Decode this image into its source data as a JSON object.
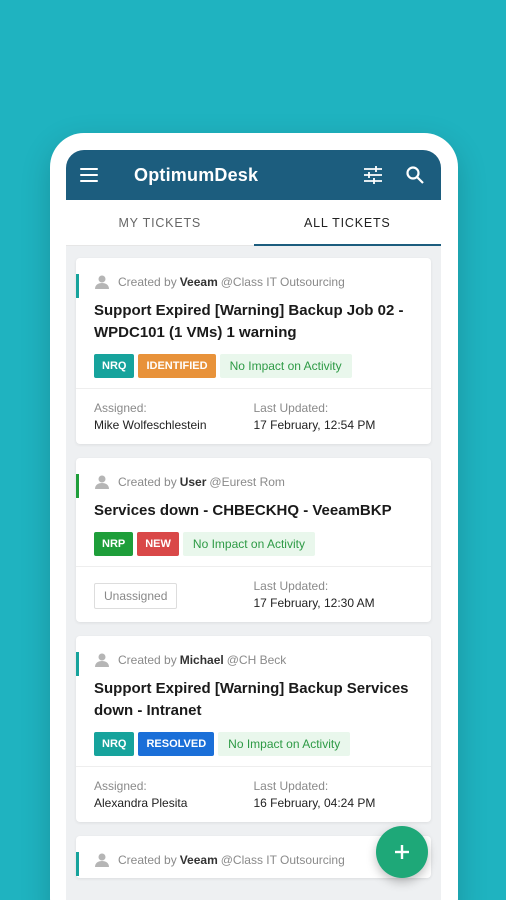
{
  "appbar": {
    "title": "OptimumDesk",
    "menu_icon": "hamburger-menu-icon",
    "filter_icon": "sliders-filter-icon",
    "search_icon": "search-icon"
  },
  "tabs": [
    {
      "label": "MY TICKETS",
      "active": false
    },
    {
      "label": "ALL TICKETS",
      "active": true
    }
  ],
  "colors": {
    "background": "#1fb3c0",
    "appbar": "#1c5d7e",
    "fab": "#1ea878"
  },
  "tickets": [
    {
      "created_prefix": "Created by",
      "creator": "Veeam",
      "org": "@Class IT Outsourcing",
      "subject": "Support Expired [Warning] Backup Job 02 - WPDC101 (1 VMs) 1 warning",
      "badges": [
        "NRQ",
        "IDENTIFIED"
      ],
      "impact": "No Impact on Activity",
      "assigned_label": "Assigned:",
      "assigned": "Mike Wolfeschlestein",
      "updated_label": "Last Updated:",
      "updated": "17 February, 12:54 PM"
    },
    {
      "created_prefix": "Created by",
      "creator": "User",
      "org": "@Eurest Rom",
      "subject": "Services down - CHBECKHQ - VeeamBKP",
      "badges": [
        "NRP",
        "NEW"
      ],
      "impact": "No Impact on Activity",
      "unassigned": "Unassigned",
      "updated_label": "Last Updated:",
      "updated": "17 February, 12:30 AM"
    },
    {
      "created_prefix": "Created by",
      "creator": "Michael",
      "org": "@CH Beck",
      "subject": "Support Expired [Warning] Backup Services down - Intranet",
      "badges": [
        "NRQ",
        "RESOLVED"
      ],
      "impact": "No Impact on Activity",
      "assigned_label": "Assigned:",
      "assigned": "Alexandra Plesita",
      "updated_label": "Last Updated:",
      "updated": "16 February, 04:24 PM"
    },
    {
      "created_prefix": "Created by",
      "creator": "Veeam",
      "org": "@Class IT Outsourcing"
    }
  ],
  "fab": {
    "icon": "plus-icon"
  }
}
